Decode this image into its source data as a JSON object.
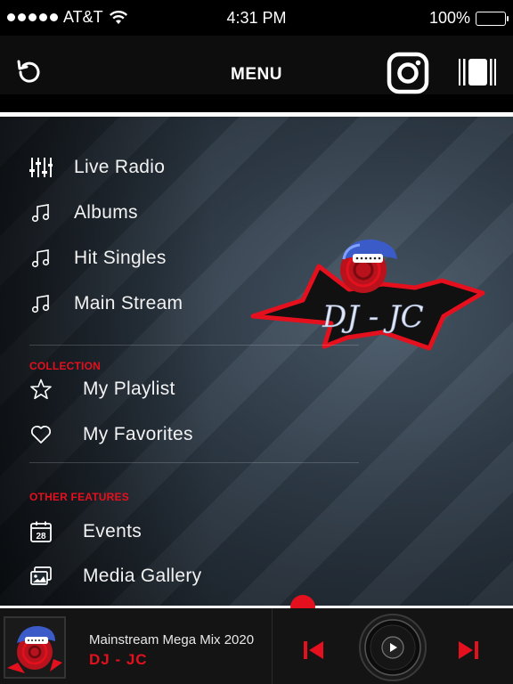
{
  "status_bar": {
    "carrier": "AT&T",
    "time": "4:31 PM",
    "battery": "100%"
  },
  "header": {
    "title": "MENU",
    "icons": [
      "refresh-icon",
      "instagram-icon",
      "stop-icon"
    ]
  },
  "menu": {
    "items": [
      {
        "label": "Live Radio",
        "icon": "equalizer-icon"
      },
      {
        "label": "Albums",
        "icon": "music-note-icon"
      },
      {
        "label": "Hit Singles",
        "icon": "music-note-icon"
      },
      {
        "label": "Main Stream",
        "icon": "music-note-icon"
      }
    ],
    "collection": {
      "heading": "COLLECTION",
      "items": [
        {
          "label": "My Playlist",
          "icon": "star-icon"
        },
        {
          "label": "My Favorites",
          "icon": "heart-icon"
        }
      ]
    },
    "other_features": {
      "heading": "OTHER FEATURES",
      "items": [
        {
          "label": "Events",
          "icon": "calendar-icon",
          "icon_text": "28"
        },
        {
          "label": "Media Gallery",
          "icon": "gallery-icon"
        }
      ]
    },
    "logo_text": "DJ - JC"
  },
  "player": {
    "track_title": "Mainstream Mega Mix 2020",
    "artist": "DJ - JC",
    "progress": 0.59,
    "accent_color": "#e5101e"
  }
}
